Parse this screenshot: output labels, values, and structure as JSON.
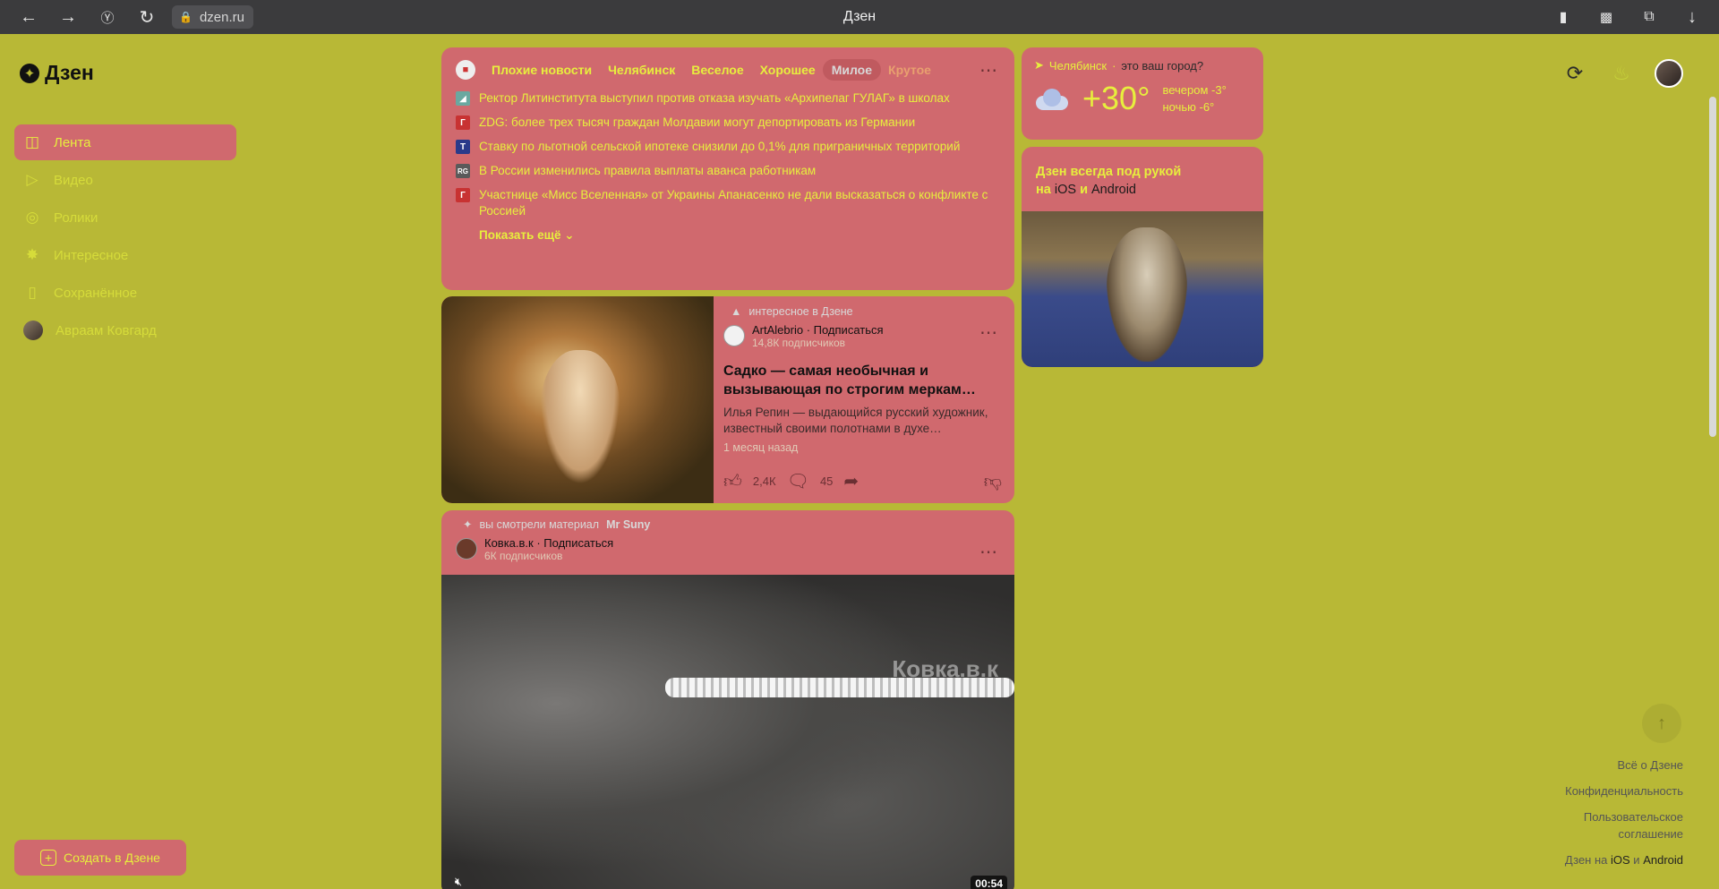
{
  "browser": {
    "tab_title": "Дзен",
    "url": "dzen.ru"
  },
  "logo": {
    "text": "Дзен"
  },
  "sidebar": {
    "items": [
      {
        "label": "Лента",
        "icon": "feed-icon",
        "active": true
      },
      {
        "label": "Видео",
        "icon": "play-icon"
      },
      {
        "label": "Ролики",
        "icon": "shorts-icon"
      },
      {
        "label": "Интересное",
        "icon": "interesting-icon"
      },
      {
        "label": "Сохранённое",
        "icon": "bookmark-icon"
      },
      {
        "label": "Авраам Ковгард",
        "icon": "avatar"
      }
    ],
    "create_label": "Создать в Дзене"
  },
  "news": {
    "tabs": [
      "Плохие новости",
      "Челябинск",
      "Веселое",
      "Хорошее",
      "Милое",
      "Крутое"
    ],
    "selected_tab": "Милое",
    "items": [
      {
        "text": "Ректор Литинститута выступил против отказа изучать «Архипелаг ГУЛАГ» в школах",
        "src_color": "#6aa8a0"
      },
      {
        "text": "ZDG: более трех тысяч граждан Молдавии могут депортировать из Германии",
        "src_color": "#c83232"
      },
      {
        "text": "Ставку по льготной сельской ипотеке снизили до 0,1% для приграничных территорий",
        "src_color": "#2a3a8a"
      },
      {
        "text": "В России изменились правила выплаты аванса работникам",
        "src_color": "#5a5a5a"
      },
      {
        "text": "Участнице «Мисс Вселенная» от Украины Апанасенко не дали высказаться о конфликте с Россией",
        "src_color": "#c83232"
      }
    ],
    "show_more": "Показать ещё"
  },
  "article": {
    "promo": "интересное в Дзене",
    "author": "ArtAlebrio",
    "subscribe": "Подписаться",
    "subscribers": "14,8К подписчиков",
    "title": "Садко — самая необычная и вызывающая по строгим меркам…",
    "desc": "Илья Репин — выдающийся русский художник, известный своими полотнами в духе…",
    "time": "1 месяц назад",
    "likes": "2,4К",
    "comments": "45"
  },
  "video": {
    "history_prefix": "вы смотрели материал",
    "history_source": "Mr Suny",
    "author": "Ковка.в.к",
    "subscribe": "Подписаться",
    "subscribers": "6К подписчиков",
    "watermark": "Ковка.в.к",
    "duration": "00:54"
  },
  "weather": {
    "city": "Челябинск",
    "question": "это ваш город?",
    "temp": "+30°",
    "evening": "вечером -3°",
    "night": "ночью -6°"
  },
  "app_promo": {
    "line1": "Дзен всегда под рукой",
    "line2_pre": "на",
    "ios": "iOS",
    "and": "и",
    "android": "Android"
  },
  "footer": {
    "about": "Всё о Дзене",
    "privacy": "Конфиденциальность",
    "terms1": "Пользовательское",
    "terms2": "соглашение",
    "apps_pre": "Дзен на",
    "apps_ios": "iOS",
    "apps_and": "и",
    "apps_android": "Android"
  }
}
